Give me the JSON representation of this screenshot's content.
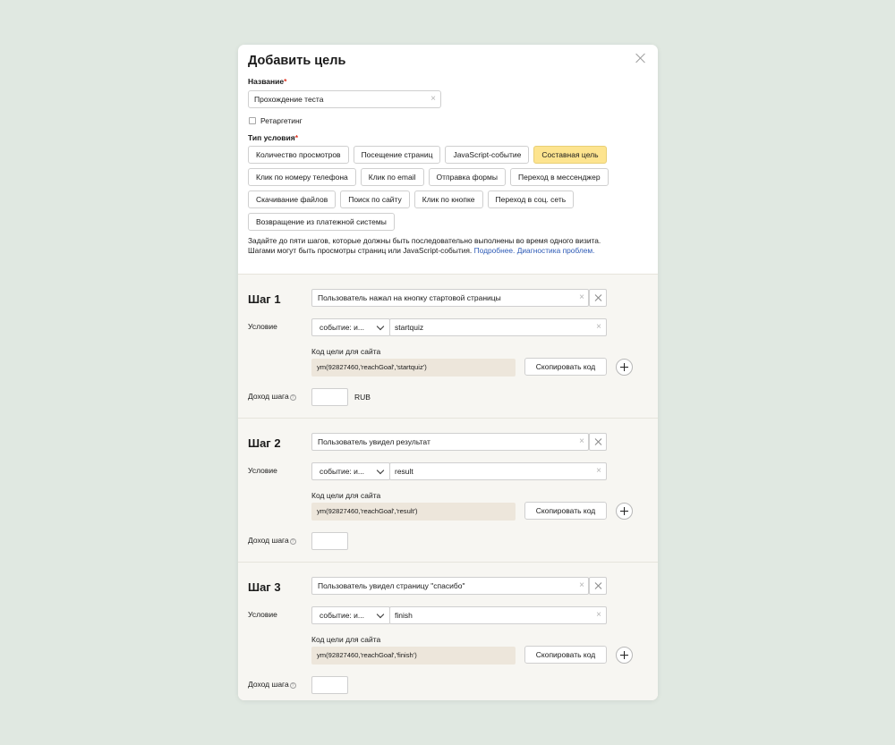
{
  "modal": {
    "title": "Добавить цель",
    "name_label": "Название",
    "required_mark": "*",
    "name_value": "Прохождение теста",
    "retargeting_label": "Ретаргетинг",
    "type_label": "Тип условия",
    "condition_types": [
      "Количество просмотров",
      "Посещение страниц",
      "JavaScript-событие",
      "Составная цель",
      "Клик по номеру телефона",
      "Клик по email",
      "Отправка формы",
      "Переход в мессенджер",
      "Скачивание файлов",
      "Поиск по сайту",
      "Клик по кнопке",
      "Переход в соц. сеть",
      "Возвращение из платежной системы"
    ],
    "active_type": "Составная цель",
    "hint_line1": "Задайте до пяти шагов, которые должны быть последовательно выполнены во время одного визита.",
    "hint_line2": "Шагами могут быть просмотры страниц или JavaScript-события.",
    "link_more": "Подробнее.",
    "link_diag": "Диагностика проблем."
  },
  "step_labels": {
    "condition": "Условие",
    "code": "Код цели для сайта",
    "copy": "Скопировать код",
    "income": "Доход шага",
    "info_glyph": "?",
    "clear_glyph": "×"
  },
  "steps": [
    {
      "title": "Шаг 1",
      "name": "Пользователь нажал на кнопку стартовой страницы",
      "selector": "событие: и...",
      "event": "startquiz",
      "code": "ym(92827460,'reachGoal','startquiz')",
      "income": "",
      "currency": "RUB"
    },
    {
      "title": "Шаг 2",
      "name": "Пользователь увидел результат",
      "selector": "событие: и...",
      "event": "result",
      "code": "ym(92827460,'reachGoal','result')",
      "income": "",
      "currency": ""
    },
    {
      "title": "Шаг 3",
      "name": "Пользователь увидел страницу \"спасибо\"",
      "selector": "событие: и...",
      "event": "finish",
      "code": "ym(92827460,'reachGoal','finish')",
      "income": "",
      "currency": ""
    }
  ],
  "colors": {
    "page_bg": "#e0e8e1",
    "active_chip": "#fde48f",
    "step_bg": "#f7f6f2",
    "code_bg": "#ede6db",
    "link": "#2e5bb6",
    "required": "#e0321f"
  }
}
